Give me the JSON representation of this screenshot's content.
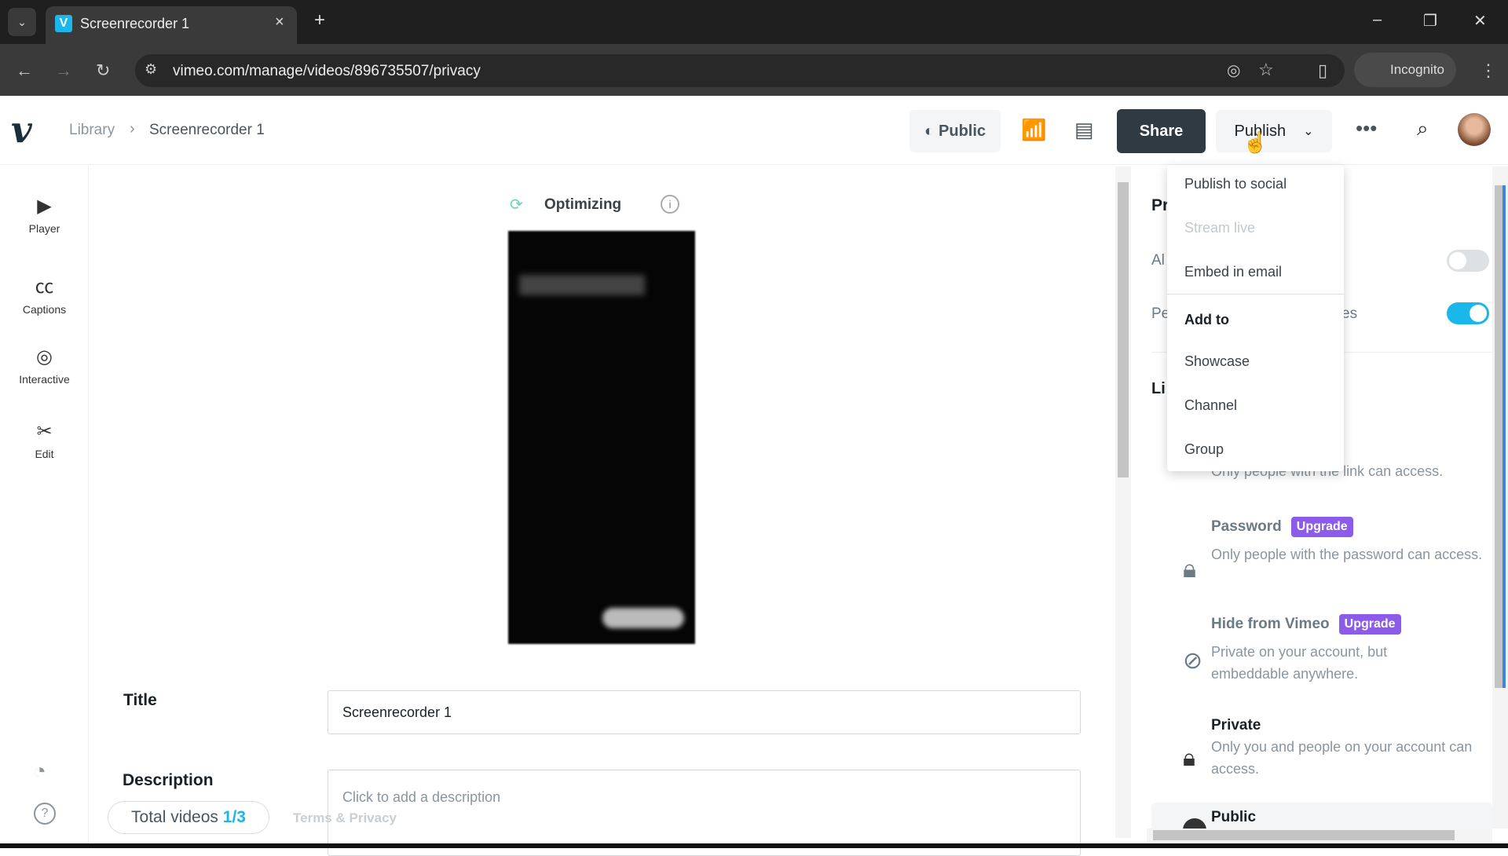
{
  "browser": {
    "tab_title": "Screenrecorder 1",
    "url": "vimeo.com/manage/videos/896735507/privacy",
    "incognito": "Incognito"
  },
  "header": {
    "breadcrumb_library": "Library",
    "breadcrumb_current": "Screenrecorder 1",
    "privacy_btn": "Public",
    "share": "Share",
    "publish": "Publish"
  },
  "sidebar": {
    "items": [
      {
        "label": "Player",
        "icon": "play-square-icon"
      },
      {
        "label": "Captions",
        "icon": "cc-icon"
      },
      {
        "label": "Interactive",
        "icon": "interactive-icon"
      },
      {
        "label": "Edit",
        "icon": "scissors-icon"
      }
    ]
  },
  "main": {
    "status": "Optimizing",
    "title_label": "Title",
    "title_value": "Screenrecorder 1",
    "description_label": "Description",
    "description_placeholder": "Click to add a description",
    "total_videos_label": "Total videos",
    "total_videos_value": "1/3",
    "terms": "Terms & Privacy"
  },
  "dropdown": {
    "items": [
      "Publish to social",
      "Stream live",
      "Embed in email"
    ],
    "section": "Add to",
    "add_items": [
      "Showcase",
      "Channel",
      "Group"
    ]
  },
  "panel": {
    "heading_partial": "Pr",
    "row1_partial": "Al",
    "row2_partial_left": "Pe",
    "row2_partial_right": "es",
    "row1_toggle": false,
    "row2_toggle": true,
    "link_heading_partial": "Li",
    "link_desc": "Only people with the link can access.",
    "options": [
      {
        "title": "Password",
        "badge": "Upgrade",
        "desc": "Only people with the password can access."
      },
      {
        "title": "Hide from Vimeo",
        "badge": "Upgrade",
        "desc": "Private on your account, but embeddable anywhere."
      },
      {
        "title": "Private",
        "desc": "Only you and people on your account can access."
      },
      {
        "title": "Public"
      }
    ]
  },
  "colors": {
    "accent": "#1ab7ea",
    "upgrade": "#8c5bea",
    "share_bg": "#2f3a43"
  }
}
